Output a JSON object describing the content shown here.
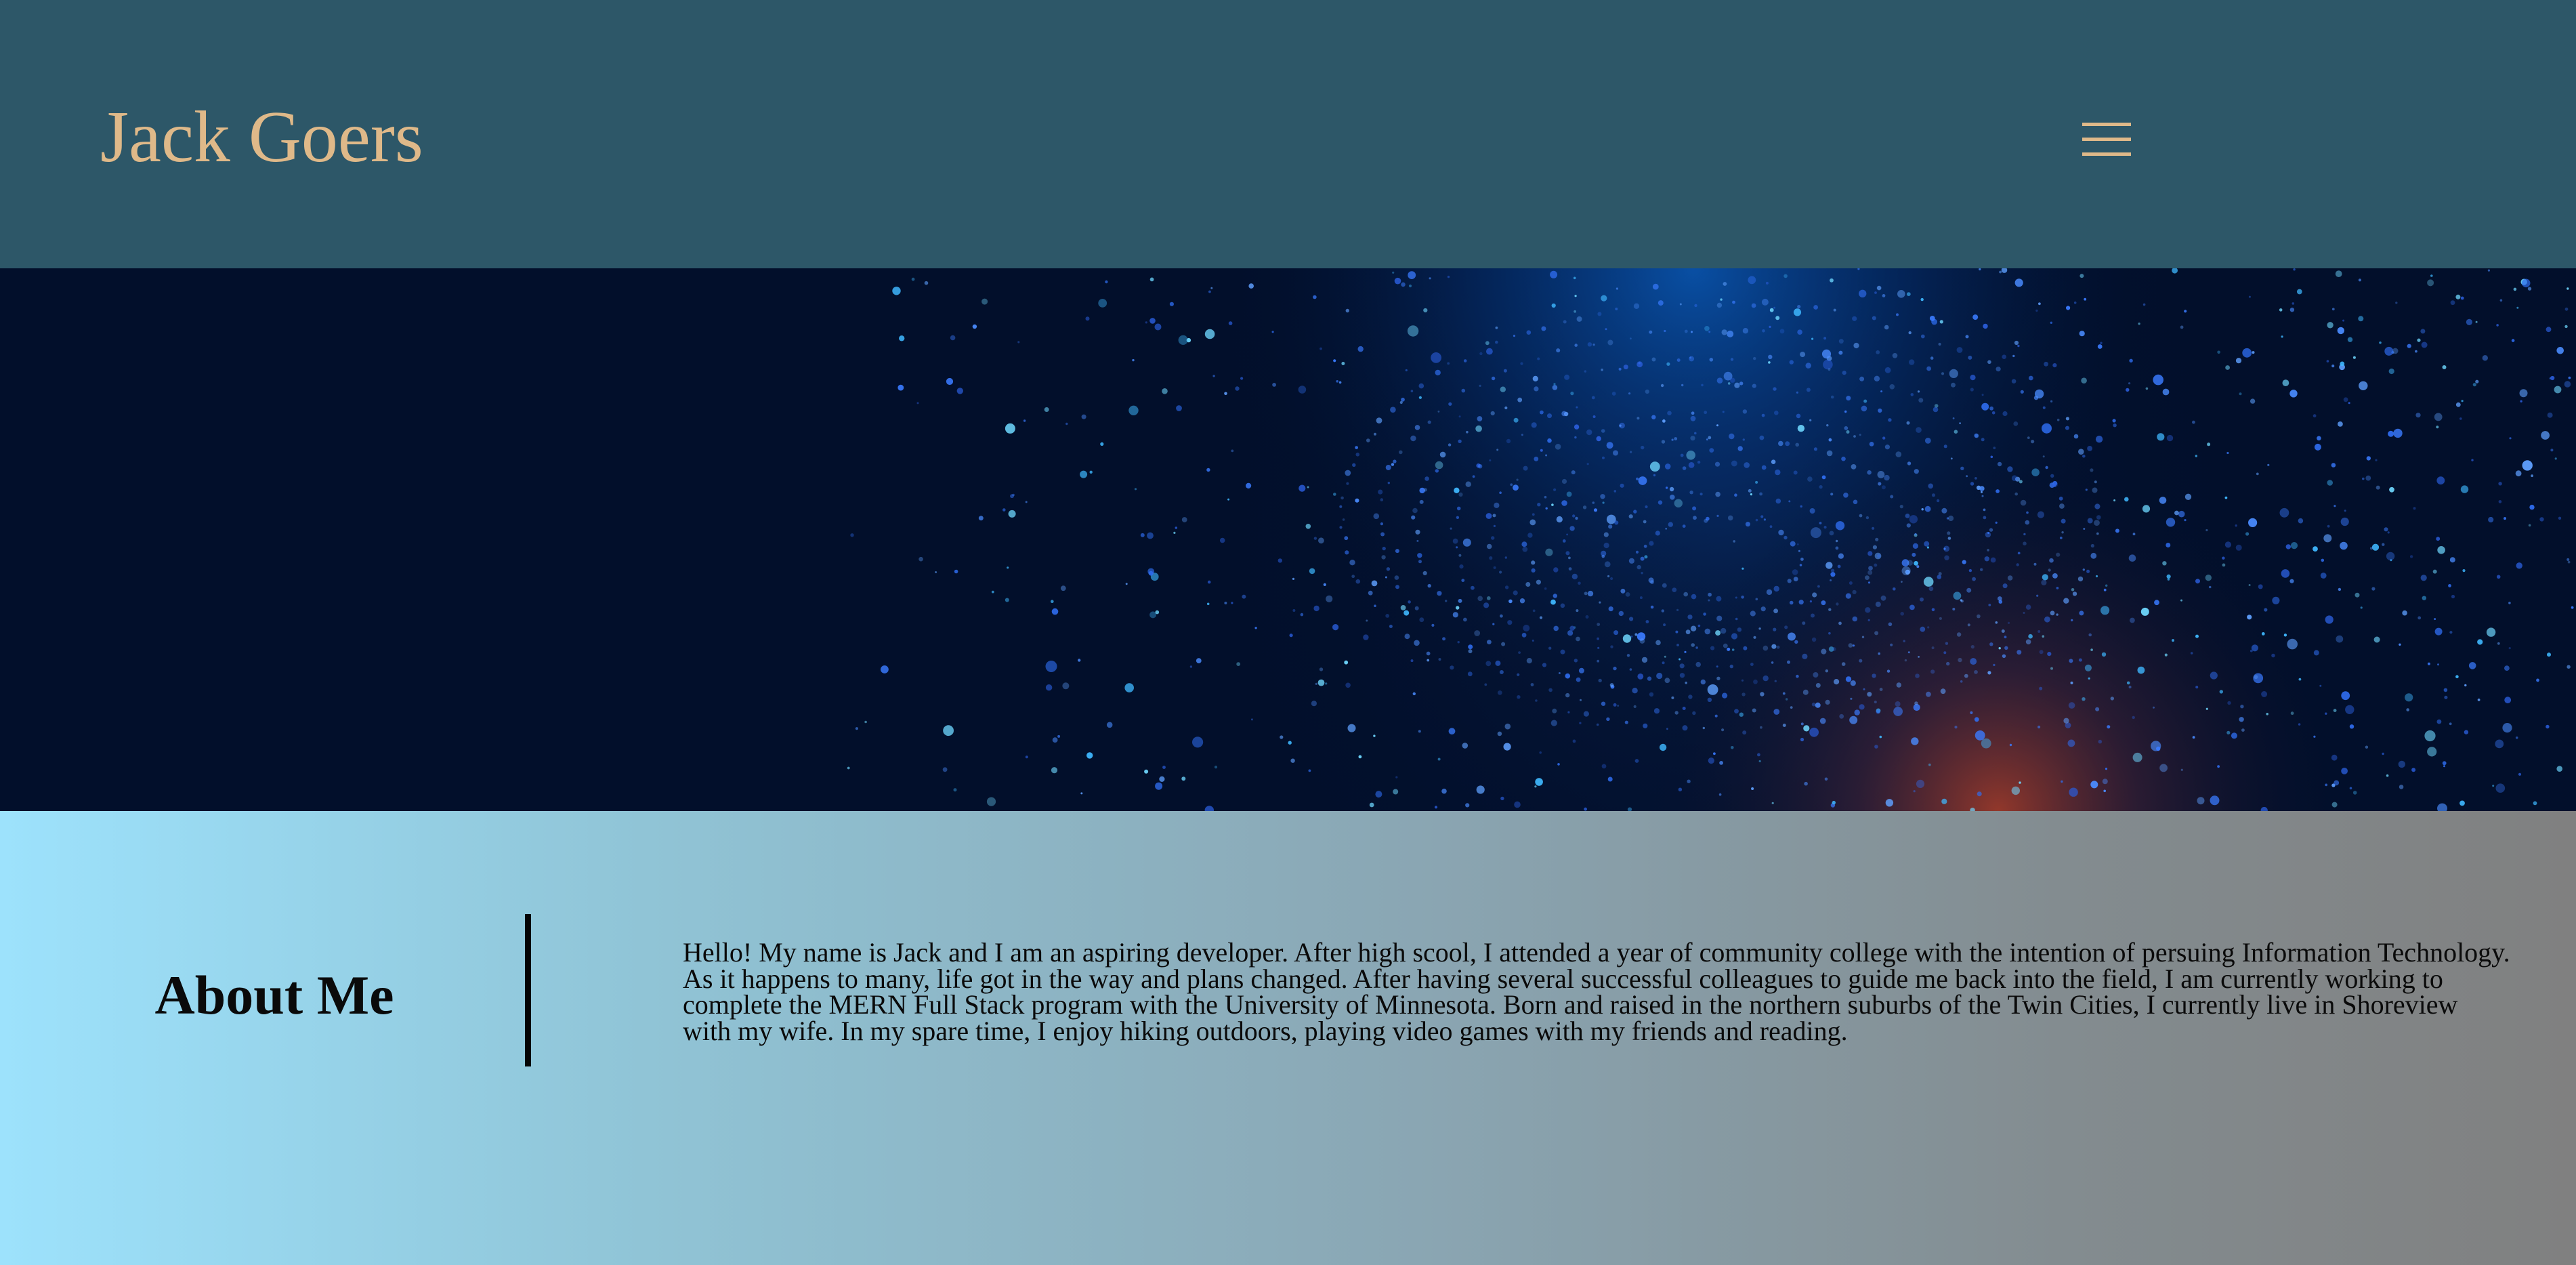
{
  "header": {
    "brand": "Jack Goers",
    "menu_icon": "hamburger-menu-icon",
    "background_color": "#2d5768",
    "accent_color": "#dfb989"
  },
  "hero": {
    "image": "starfield-particle-vortex-banner"
  },
  "about": {
    "title": "About Me",
    "body": "Hello! My name is Jack and I am an aspiring developer. After high scool, I attended a year of community college with the intention of persuing Information Technology. As it happens to many, life got in the way and plans changed. After having several successful colleagues to guide me back into the field, I am currently working to complete the MERN Full Stack program with the University of Minnesota. Born and raised in the northern suburbs of the Twin Cities, I currently live in Shoreview with my wife. In my spare time, I enjoy hiking outdoors, playing video games with my friends and reading."
  }
}
